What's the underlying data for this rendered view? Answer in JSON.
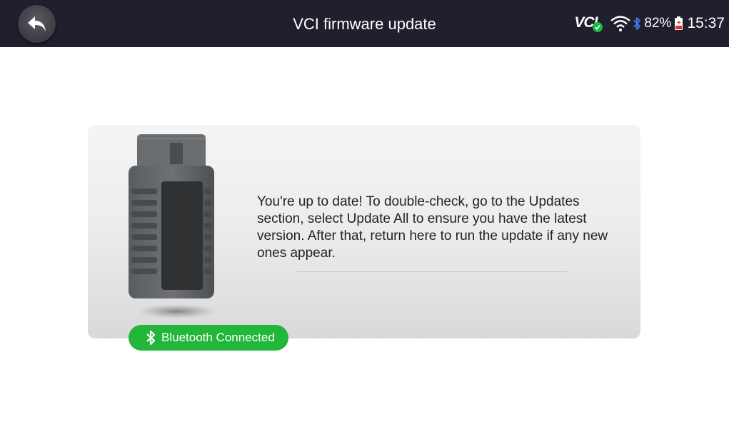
{
  "header": {
    "title": "VCI firmware update",
    "back_icon": "back-arrow-icon"
  },
  "status_bar": {
    "vci_label": "VCI",
    "vci_status_color": "#1ab83e",
    "wifi_icon": "wifi-icon",
    "bluetooth_icon": "bluetooth-icon",
    "battery_percent": "82%",
    "battery_fill_color": "#e03030",
    "time": "15:37"
  },
  "main": {
    "device_image": "obd-vci-dongle",
    "message": "You're up to date! To double-check, go to the Updates section, select Update All to ensure you have the latest version. After that, return here to run the update if any new ones appear.",
    "connection_badge": {
      "label": "Bluetooth Connected",
      "icon": "bluetooth-icon",
      "color": "#22b63a"
    }
  }
}
